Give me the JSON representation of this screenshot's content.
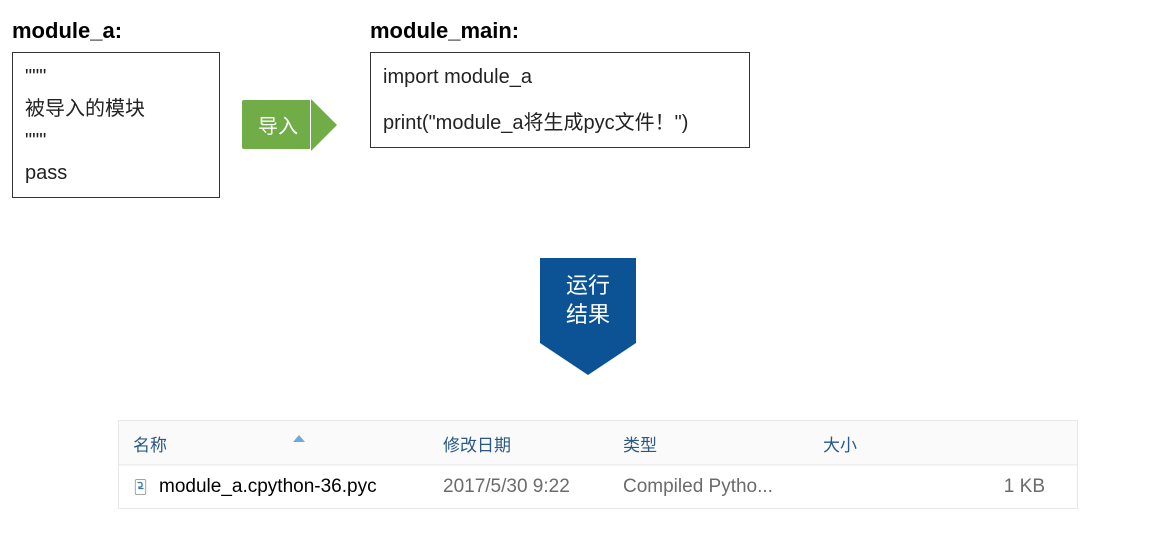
{
  "module_a": {
    "title": "module_a:",
    "code": "\"\"\"\n被导入的模块\n\"\"\"\npass"
  },
  "module_main": {
    "title": "module_main:",
    "code_line1": "import module_a",
    "code_line2": "print(\"module_a将生成pyc文件！\")"
  },
  "import_arrow": {
    "label": "导入"
  },
  "result_banner": {
    "line1": "运行",
    "line2": "结果"
  },
  "file_list": {
    "headers": {
      "name": "名称",
      "date": "修改日期",
      "type": "类型",
      "size": "大小"
    },
    "row": {
      "name": "module_a.cpython-36.pyc",
      "date": "2017/5/30 9:22",
      "type": "Compiled Pytho...",
      "size": "1 KB"
    }
  }
}
